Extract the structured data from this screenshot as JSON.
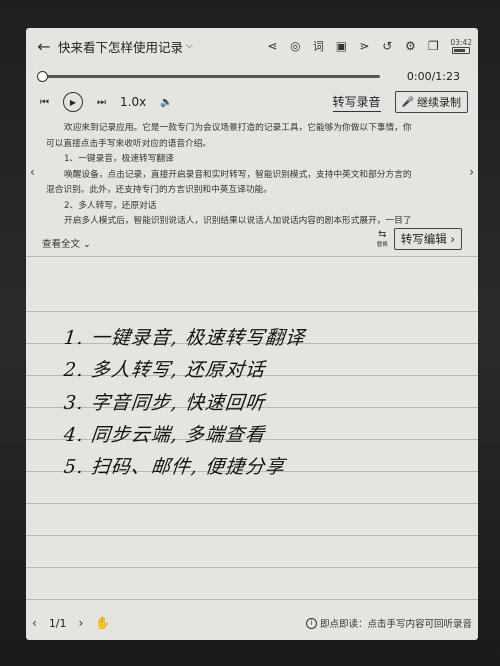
{
  "header": {
    "title": "快来看下怎样使用记录",
    "status_time": "03:42",
    "battery_level": 0.7,
    "icons": [
      "share-nodes-icon",
      "audio-text-icon",
      "dictionary-icon",
      "image-icon",
      "share-icon",
      "history-icon",
      "settings-icon",
      "pages-icon"
    ]
  },
  "player": {
    "time": "0:00/1:23",
    "progress": 0,
    "speed": "1.0x",
    "transcribe_audio_label": "转写录音",
    "continue_record_label": "继续录制"
  },
  "transcript": {
    "lines": [
      "欢迎来到记录应用。它是一款专门为会议场景打造的记录工具，它能够为你做以下事情，你",
      "可以直接点击手写来收听对应的语音介绍。",
      "1、一键录音，极速转写翻译",
      "唤醒设备，点击记录，直接开启录音和实时转写，智能识别模式，支持中英文和部分方言的",
      "混合识别。此外，还支持专门的方言识别和中英互译功能。",
      "2、多人转写，还原对话",
      "开启多人模式后，智能识别说话人，识别结果以说话人加说话内容的剧本形式展开，一目了"
    ],
    "expand_label": "查看全文",
    "replace_label": "替换",
    "edit_label": "转写编辑"
  },
  "handwriting": [
    "1. 一键录音, 极速转写翻译",
    "2. 多人转写, 还原对话",
    "3. 字音同步, 快速回听",
    "4. 同步云端, 多端查看",
    "5. 扫码、邮件, 便捷分享"
  ],
  "footer": {
    "page": "1/1",
    "hint": "即点即读：点击手写内容可回听录音"
  }
}
